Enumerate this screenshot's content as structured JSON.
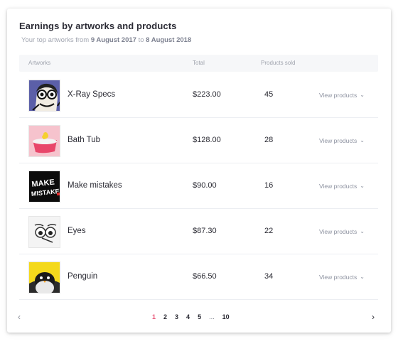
{
  "header": {
    "title": "Earnings by artworks and products",
    "subtitle_prefix": "Your top artworks from",
    "date_from": "9 August 2017",
    "subtitle_mid": "to",
    "date_to": "8 August 2018"
  },
  "table": {
    "columns": [
      "Artworks",
      "Total",
      "Products sold"
    ],
    "rows": [
      {
        "name": "X-Ray Specs",
        "total": "$223.00",
        "sold": "45",
        "action": "View products"
      },
      {
        "name": "Bath Tub",
        "total": "$128.00",
        "sold": "28",
        "action": "View products"
      },
      {
        "name": "Make mistakes",
        "total": "$90.00",
        "sold": "16",
        "action": "View products"
      },
      {
        "name": "Eyes",
        "total": "$87.30",
        "sold": "22",
        "action": "View products"
      },
      {
        "name": "Penguin",
        "total": "$66.50",
        "sold": "34",
        "action": "View products"
      }
    ],
    "thumbnail_texts": {
      "make_mistakes": "MAKE MISTAKES"
    }
  },
  "pagination": {
    "pages": [
      "1",
      "2",
      "3",
      "4",
      "5",
      "...",
      "10"
    ],
    "current": "1",
    "prev_icon": "chevron-left-icon",
    "next_icon": "chevron-right-icon"
  },
  "colors": {
    "accent": "#e8587a",
    "header_bg": "#f6f7f9",
    "muted_text": "#a3a7b2"
  }
}
